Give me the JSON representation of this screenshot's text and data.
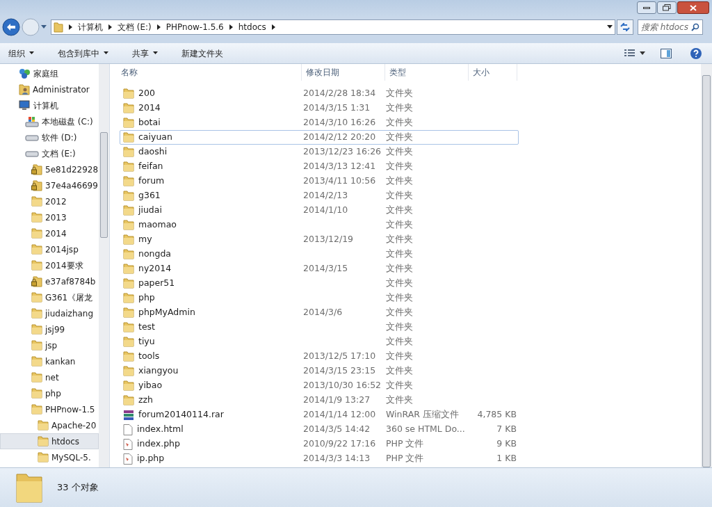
{
  "address_bar": {
    "path": [
      "计算机",
      "文档 (E:)",
      "PHPnow-1.5.6",
      "htdocs"
    ],
    "search_placeholder": "搜索 htdocs"
  },
  "toolbar": {
    "items": [
      {
        "label": "组织",
        "dropdown": true
      },
      {
        "label": "包含到库中",
        "dropdown": true
      },
      {
        "label": "共享",
        "dropdown": true
      },
      {
        "label": "新建文件夹",
        "dropdown": false
      }
    ]
  },
  "sidebar": {
    "items": [
      {
        "label": "家庭组",
        "kind": "homegroup",
        "selected": false
      },
      {
        "label": "Administrator",
        "kind": "user",
        "selected": false
      },
      {
        "label": "计算机",
        "kind": "computer",
        "selected": false,
        "children": [
          {
            "label": "本地磁盘 (C:)",
            "kind": "system_drive",
            "selected": false
          },
          {
            "label": "软件 (D:)",
            "kind": "drive",
            "selected": false
          },
          {
            "label": "文档 (E:)",
            "kind": "drive",
            "selected": false,
            "children": [
              {
                "label": "5e81d22928",
                "kind": "locked_folder",
                "selected": false
              },
              {
                "label": "37e4a46699",
                "kind": "locked_folder",
                "selected": false
              },
              {
                "label": "2012",
                "kind": "folder",
                "selected": false
              },
              {
                "label": "2013",
                "kind": "folder",
                "selected": false
              },
              {
                "label": "2014",
                "kind": "folder",
                "selected": false
              },
              {
                "label": "2014jsp",
                "kind": "folder",
                "selected": false
              },
              {
                "label": "2014要求",
                "kind": "folder",
                "selected": false
              },
              {
                "label": "e37af8784b",
                "kind": "locked_folder",
                "selected": false
              },
              {
                "label": "G361《屠龙",
                "kind": "folder",
                "selected": false
              },
              {
                "label": "jiudaizhang",
                "kind": "folder",
                "selected": false
              },
              {
                "label": "jsj99",
                "kind": "folder",
                "selected": false
              },
              {
                "label": "jsp",
                "kind": "folder",
                "selected": false
              },
              {
                "label": "kankan",
                "kind": "folder",
                "selected": false
              },
              {
                "label": "net",
                "kind": "folder",
                "selected": false
              },
              {
                "label": "php",
                "kind": "folder",
                "selected": false
              },
              {
                "label": "PHPnow-1.5",
                "kind": "folder",
                "selected": false,
                "children": [
                  {
                    "label": "Apache-20",
                    "kind": "folder",
                    "selected": false
                  },
                  {
                    "label": "htdocs",
                    "kind": "folder",
                    "selected": true
                  },
                  {
                    "label": "MySQL-5.",
                    "kind": "folder",
                    "selected": false
                  }
                ]
              }
            ]
          }
        ]
      }
    ]
  },
  "file_list": {
    "columns": [
      "名称",
      "修改日期",
      "类型",
      "大小"
    ],
    "rows": [
      {
        "name": "200",
        "kind": "folder",
        "date": "2014/2/28 18:34",
        "type": "文件夹",
        "focused": false
      },
      {
        "name": "2014",
        "kind": "folder",
        "date": "2014/3/15 1:31",
        "type": "文件夹",
        "focused": false
      },
      {
        "name": "botai",
        "kind": "folder",
        "date": "2014/3/10 16:26",
        "type": "文件夹",
        "focused": false
      },
      {
        "name": "caiyuan",
        "kind": "folder",
        "date": "2014/2/12 20:20",
        "type": "文件夹",
        "focused": true
      },
      {
        "name": "daoshi",
        "kind": "folder",
        "date": "2013/12/23 16:26",
        "type": "文件夹",
        "focused": false
      },
      {
        "name": "feifan",
        "kind": "folder",
        "date": "2014/3/13 12:41",
        "type": "文件夹",
        "focused": false
      },
      {
        "name": "forum",
        "kind": "folder",
        "date": "2013/4/11 10:56",
        "type": "文件夹",
        "focused": false
      },
      {
        "name": "g361",
        "kind": "folder",
        "date": "2014/2/13",
        "type": "文件夹",
        "focused": false
      },
      {
        "name": "jiudai",
        "kind": "folder",
        "date": "2014/1/10",
        "type": "文件夹",
        "focused": false
      },
      {
        "name": "maomao",
        "kind": "folder",
        "type": "文件夹",
        "focused": false
      },
      {
        "name": "my",
        "kind": "folder",
        "date": "2013/12/19",
        "type": "文件夹",
        "focused": false
      },
      {
        "name": "nongda",
        "kind": "folder",
        "type": "文件夹",
        "focused": false
      },
      {
        "name": "ny2014",
        "kind": "folder",
        "date": "2014/3/15",
        "type": "文件夹",
        "focused": false
      },
      {
        "name": "paper51",
        "kind": "folder",
        "type": "文件夹",
        "focused": false
      },
      {
        "name": "php",
        "kind": "folder",
        "type": "文件夹",
        "focused": false
      },
      {
        "name": "phpMyAdmin",
        "kind": "folder",
        "date": "2014/3/6",
        "type": "文件夹",
        "focused": false
      },
      {
        "name": "test",
        "kind": "folder",
        "type": "文件夹",
        "focused": false
      },
      {
        "name": "tiyu",
        "kind": "folder",
        "type": "文件夹",
        "focused": false
      },
      {
        "name": "tools",
        "kind": "folder",
        "date": "2013/12/5 17:10",
        "type": "文件夹",
        "focused": false
      },
      {
        "name": "xiangyou",
        "kind": "folder",
        "date": "2014/3/15 23:15",
        "type": "文件夹",
        "focused": false
      },
      {
        "name": "yibao",
        "kind": "folder",
        "date": "2013/10/30 16:52",
        "type": "文件夹",
        "focused": false
      },
      {
        "name": "zzh",
        "kind": "folder",
        "date": "2014/1/9 13:27",
        "type": "文件夹",
        "focused": false
      },
      {
        "name": "forum20140114.rar",
        "kind": "archive",
        "date": "2014/1/14 12:00",
        "type": "WinRAR 压缩文件",
        "size": "4,785 KB",
        "focused": false
      },
      {
        "name": "index.html",
        "kind": "html",
        "date": "2014/3/5 14:42",
        "type": "360 se HTML Do...",
        "size": "7 KB",
        "focused": false
      },
      {
        "name": "index.php",
        "kind": "php",
        "date": "2010/9/22 17:16",
        "type": "PHP 文件",
        "size": "9 KB",
        "focused": false
      },
      {
        "name": "ip.php",
        "kind": "php",
        "date": "2014/3/3 14:13",
        "type": "PHP 文件",
        "size": "1 KB",
        "focused": false
      }
    ]
  },
  "status_bar": {
    "text": "33 个对象"
  }
}
